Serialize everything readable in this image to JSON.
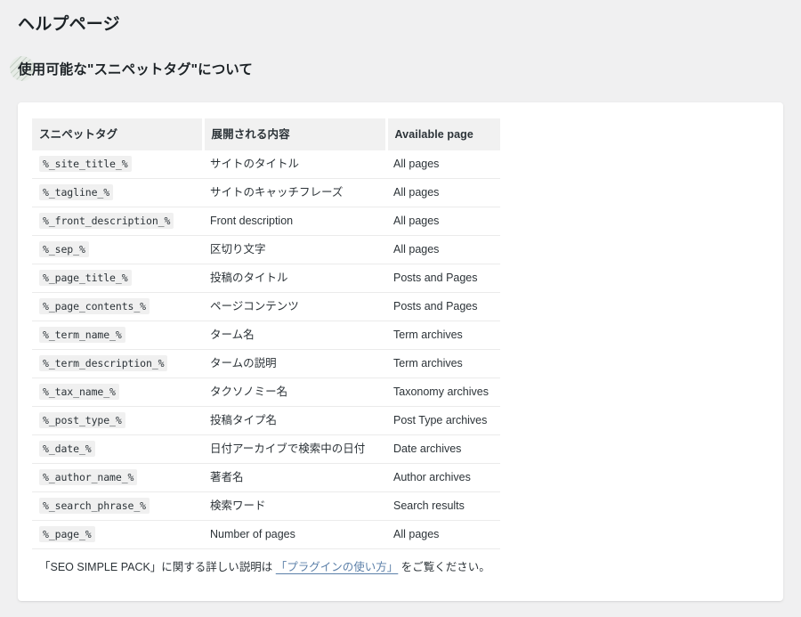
{
  "page": {
    "title": "ヘルプページ",
    "section_heading": "使用可能な\"スニペットタグ\"について",
    "background_color": "#f0f0f1",
    "card_background": "#ffffff",
    "link_color": "#5b7fa8",
    "header_cell_background": "#f1f1f1",
    "code_background": "#f0f0f0"
  },
  "decor": {
    "hatched_circle_name": "hatched-circle-decoration"
  },
  "table": {
    "columns": [
      "スニペットタグ",
      "展開される内容",
      "Available page"
    ],
    "rows": [
      {
        "tag": "%_site_title_%",
        "description": "サイトのタイトル",
        "available": "All pages"
      },
      {
        "tag": "%_tagline_%",
        "description": "サイトのキャッチフレーズ",
        "available": "All pages"
      },
      {
        "tag": "%_front_description_%",
        "description": "Front description",
        "available": "All pages"
      },
      {
        "tag": "%_sep_%",
        "description": "区切り文字",
        "available": "All pages"
      },
      {
        "tag": "%_page_title_%",
        "description": "投稿のタイトル",
        "available": "Posts and Pages"
      },
      {
        "tag": "%_page_contents_%",
        "description": "ページコンテンツ",
        "available": "Posts and Pages"
      },
      {
        "tag": "%_term_name_%",
        "description": "ターム名",
        "available": "Term archives"
      },
      {
        "tag": "%_term_description_%",
        "description": "タームの説明",
        "available": "Term archives"
      },
      {
        "tag": "%_tax_name_%",
        "description": "タクソノミー名",
        "available": "Taxonomy archives"
      },
      {
        "tag": "%_post_type_%",
        "description": "投稿タイプ名",
        "available": "Post Type archives"
      },
      {
        "tag": "%_date_%",
        "description": "日付アーカイブで検索中の日付",
        "available": "Date archives"
      },
      {
        "tag": "%_author_name_%",
        "description": "著者名",
        "available": "Author archives"
      },
      {
        "tag": "%_search_phrase_%",
        "description": "検索ワード",
        "available": "Search results"
      },
      {
        "tag": "%_page_%",
        "description": "Number of pages",
        "available": "All pages"
      }
    ]
  },
  "note": {
    "prefix": "「SEO SIMPLE PACK」に関する詳しい説明は ",
    "link_text": "「プラグインの使い方」",
    "suffix": " をご覧ください。"
  }
}
